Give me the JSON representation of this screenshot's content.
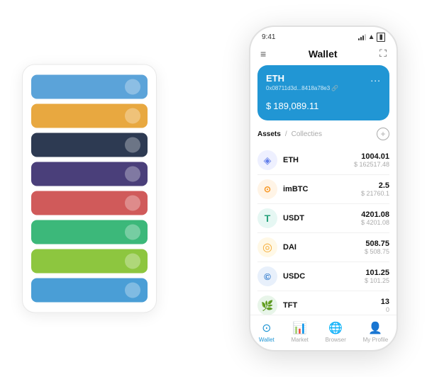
{
  "scene": {
    "card_stack": {
      "items": [
        {
          "color": "#5ba3d9",
          "icon": "◆"
        },
        {
          "color": "#e8a840",
          "icon": "◆"
        },
        {
          "color": "#2d3a52",
          "icon": "◆"
        },
        {
          "color": "#4a3f7a",
          "icon": "M"
        },
        {
          "color": "#d05a5a",
          "icon": "◆"
        },
        {
          "color": "#3cb87a",
          "icon": "◆"
        },
        {
          "color": "#8dc63f",
          "icon": "◆"
        },
        {
          "color": "#4a9ed6",
          "icon": "◆"
        }
      ]
    },
    "phone": {
      "status_bar": {
        "time": "9:41",
        "signal": "▌▌▌",
        "wifi": "wifi",
        "battery": "battery"
      },
      "header": {
        "menu_icon": "≡",
        "title": "Wallet",
        "expand_icon": "⛶"
      },
      "eth_card": {
        "title": "ETH",
        "address": "0x08711d3d...8418a78e3  🔗",
        "dots": "...",
        "currency_symbol": "$",
        "balance": "189,089.11"
      },
      "assets_section": {
        "tab_active": "Assets",
        "tab_slash": " / ",
        "tab_inactive": "Collecties",
        "add_icon": "+"
      },
      "assets": [
        {
          "name": "ETH",
          "icon": "◈",
          "icon_color": "#627eea",
          "bg_color": "#eef0ff",
          "amount": "1004.01",
          "usd": "$ 162517.48"
        },
        {
          "name": "imBTC",
          "icon": "⊙",
          "icon_color": "#f7931a",
          "bg_color": "#fff4e6",
          "amount": "2.5",
          "usd": "$ 21760.1"
        },
        {
          "name": "USDT",
          "icon": "T",
          "icon_color": "#26a17b",
          "bg_color": "#e6f7f3",
          "amount": "4201.08",
          "usd": "$ 4201.08"
        },
        {
          "name": "DAI",
          "icon": "◎",
          "icon_color": "#f5ac37",
          "bg_color": "#fff8e6",
          "amount": "508.75",
          "usd": "$ 508.75"
        },
        {
          "name": "USDC",
          "icon": "©",
          "icon_color": "#2775ca",
          "bg_color": "#e8f0fb",
          "amount": "101.25",
          "usd": "$ 101.25"
        },
        {
          "name": "TFT",
          "icon": "🌿",
          "icon_color": "#4caf50",
          "bg_color": "#e8f5e9",
          "amount": "13",
          "usd": "0"
        }
      ],
      "nav": [
        {
          "label": "Wallet",
          "icon": "⊙",
          "active": true
        },
        {
          "label": "Market",
          "icon": "📊",
          "active": false
        },
        {
          "label": "Browser",
          "icon": "🌐",
          "active": false
        },
        {
          "label": "My Profile",
          "icon": "👤",
          "active": false
        }
      ]
    }
  }
}
